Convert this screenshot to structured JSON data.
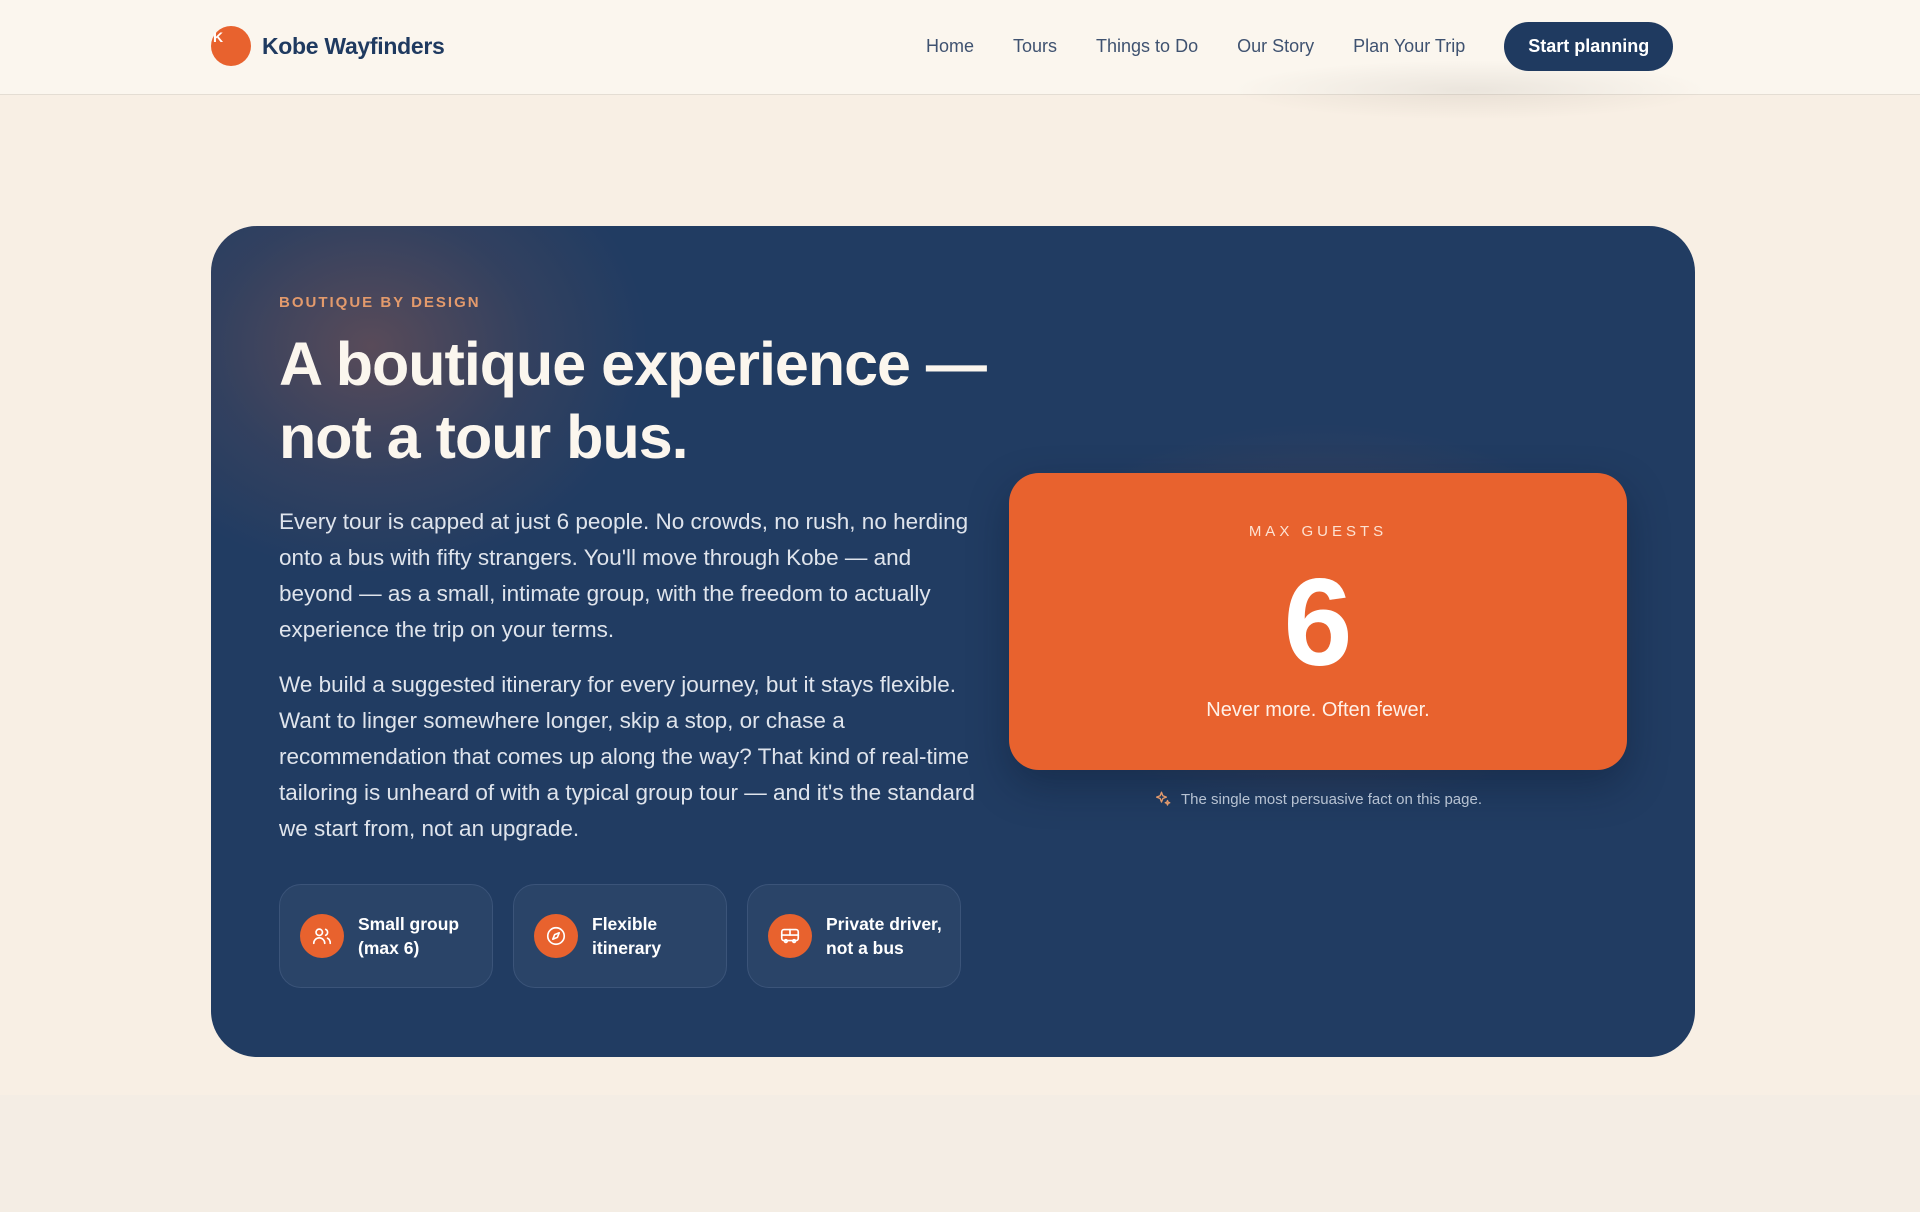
{
  "header": {
    "brand_initial": "K",
    "brand_name": "Kobe Wayfinders",
    "nav": [
      {
        "label": "Home"
      },
      {
        "label": "Tours"
      },
      {
        "label": "Things to Do"
      },
      {
        "label": "Our Story"
      },
      {
        "label": "Plan Your Trip"
      }
    ],
    "cta_label": "Start planning"
  },
  "hero": {
    "eyebrow": "BOUTIQUE BY DESIGN",
    "headline": "A boutique experience — not a tour bus.",
    "paragraph_1": "Every tour is capped at just 6 people. No crowds, no rush, no herding onto a bus with fifty strangers. You'll move through Kobe — and beyond — as a small, intimate group, with the freedom to actually experience the trip on your terms.",
    "paragraph_2": "We build a suggested itinerary for every journey, but it stays flexible. Want to linger somewhere longer, skip a stop, or chase a recommendation that comes up along the way? That kind of real-time tailoring is unheard of with a typical group tour — and it's the standard we start from, not an upgrade.",
    "features": [
      {
        "icon": "users-icon",
        "label": "Small group (max 6)"
      },
      {
        "icon": "compass-icon",
        "label": "Flexible itinerary"
      },
      {
        "icon": "van-icon",
        "label": "Private driver, not a bus"
      }
    ]
  },
  "stat": {
    "label": "MAX GUESTS",
    "value": "6",
    "caption": "Never more. Often fewer.",
    "note_icon": "sparkle-icon",
    "note": "The single most persuasive fact on this page."
  },
  "colors": {
    "accent": "#e8622e",
    "navy": "#213c62",
    "background": "#f8efe4"
  }
}
